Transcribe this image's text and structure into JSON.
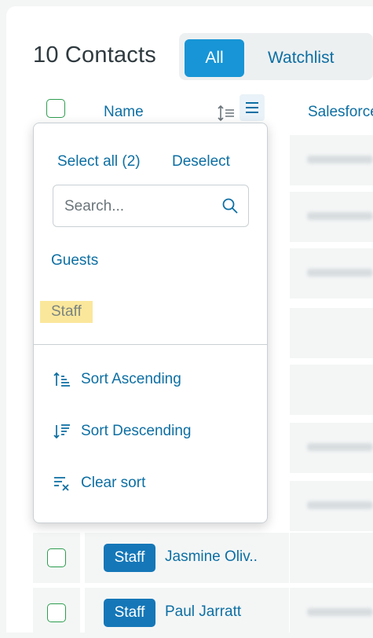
{
  "header": {
    "title": "10 Contacts",
    "tabs": [
      {
        "label": "All",
        "active": true
      },
      {
        "label": "Watchlist",
        "active": false
      }
    ]
  },
  "table": {
    "columns": {
      "name": "Name",
      "salesforce": "Salesforce"
    },
    "rows": [
      {
        "tag": "Staff",
        "name": "Jasmine Oliv.."
      },
      {
        "tag": "Staff",
        "name": "Paul Jarratt"
      }
    ]
  },
  "filter_menu": {
    "select_all": "Select all (2)",
    "deselect": "Deselect",
    "search_placeholder": "Search...",
    "options": [
      "Guests",
      "Staff"
    ],
    "actions": {
      "sort_ascending": "Sort Ascending",
      "sort_descending": "Sort Descending",
      "clear_sort": "Clear sort"
    }
  },
  "colors": {
    "accent": "#1795d6",
    "link": "#0d6fa3",
    "badge": "#1577b8",
    "highlight": "#fbe79b",
    "checkbox": "#2e9d4f"
  }
}
